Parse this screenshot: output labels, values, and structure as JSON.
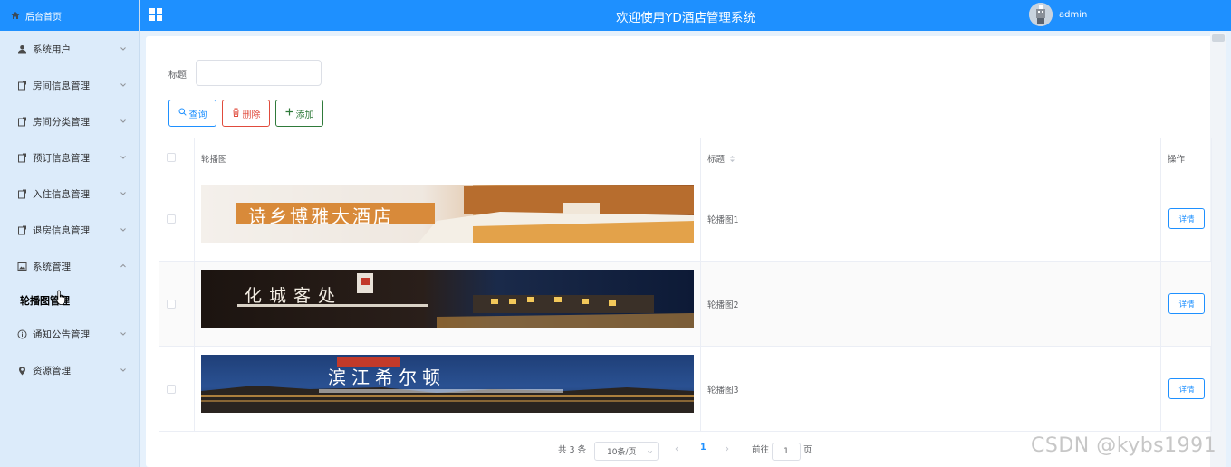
{
  "sidebar": {
    "home_label": "后台首页",
    "items": [
      {
        "label": "系统用户"
      },
      {
        "label": "房间信息管理"
      },
      {
        "label": "房间分类管理"
      },
      {
        "label": "预订信息管理"
      },
      {
        "label": "入住信息管理"
      },
      {
        "label": "退房信息管理"
      },
      {
        "label": "系统管理"
      },
      {
        "label": "通知公告管理"
      },
      {
        "label": "资源管理"
      }
    ],
    "sub_item_label": "轮播图管理"
  },
  "header": {
    "title": "欢迎使用YD酒店管理系统",
    "username": "admin"
  },
  "search": {
    "label": "标题",
    "value": "",
    "placeholder": ""
  },
  "toolbar": {
    "search_label": "查询",
    "delete_label": "删除",
    "add_label": "添加"
  },
  "table": {
    "columns": [
      "轮播图",
      "标题",
      "操作"
    ],
    "rows": [
      {
        "title": "轮播图1",
        "banner_text": "诗乡博雅大酒店",
        "action": "详情"
      },
      {
        "title": "轮播图2",
        "banner_text": "化城客处",
        "action": "详情"
      },
      {
        "title": "轮播图3",
        "banner_text": "滨江希尔顿",
        "action": "详情"
      }
    ]
  },
  "pagination": {
    "total_text": "共 3 条",
    "page_size": "10条/页",
    "current_page": "1",
    "goto_prefix": "前往",
    "goto_value": "1",
    "goto_suffix": "页"
  },
  "watermark": "CSDN @kybs1991",
  "colors": {
    "primary": "#1e90ff",
    "danger": "#e04b3c",
    "success": "#2f7a3a",
    "sidebar_bg": "#dcebfa"
  }
}
